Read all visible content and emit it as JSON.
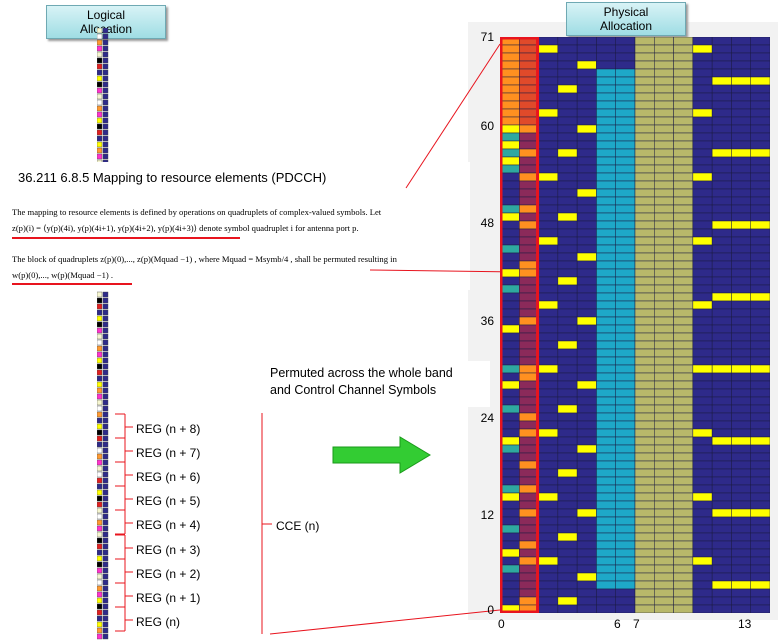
{
  "headers": {
    "logical": "Logical\nAllocation",
    "physical": "Physical\nAllocation"
  },
  "spec": {
    "title": "36.211 6.8.5 Mapping to resource elements (PDCCH)",
    "line1": "The mapping to resource elements is defined by operations on quadruplets of complex-valued symbols. Let",
    "line2": "z(p)(i) = ⟨y(p)(4i), y(p)(4i+1), y(p)(4i+2), y(p)(4i+3)⟩  denote symbol quadruplet  i  for antenna port p.",
    "line3": "The block of quadruplets z(p)(0),..., z(p)(Mquad −1) , where  Mquad = Msymb/4 , shall be permuted resulting in",
    "line4": "w(p)(0),..., w(p)(Mquad −1) ."
  },
  "regs": [
    "REG (n + 8)",
    "REG (n + 7)",
    "REG (n + 6)",
    "REG (n + 5)",
    "REG (n + 4)",
    "REG (n + 3)",
    "REG (n + 2)",
    "REG (n + 1)",
    "REG (n)"
  ],
  "cce_label": "CCE (n)",
  "permuted_label": "Permuted across the whole band\nand Control Channel Symbols",
  "y_ticks": [
    "71",
    "60",
    "48",
    "36",
    "24",
    "12",
    "0"
  ],
  "x_ticks": [
    "0",
    "6",
    "7",
    "13"
  ],
  "colors": {
    "navy": "#2e2a8a",
    "teal": "#2fa8a0",
    "cyan": "#1ea8c8",
    "olive": "#b8b86a",
    "yellow": "#ffff00",
    "orange": "#ff9020",
    "red": "#e8141e",
    "green": "#33cc33"
  }
}
